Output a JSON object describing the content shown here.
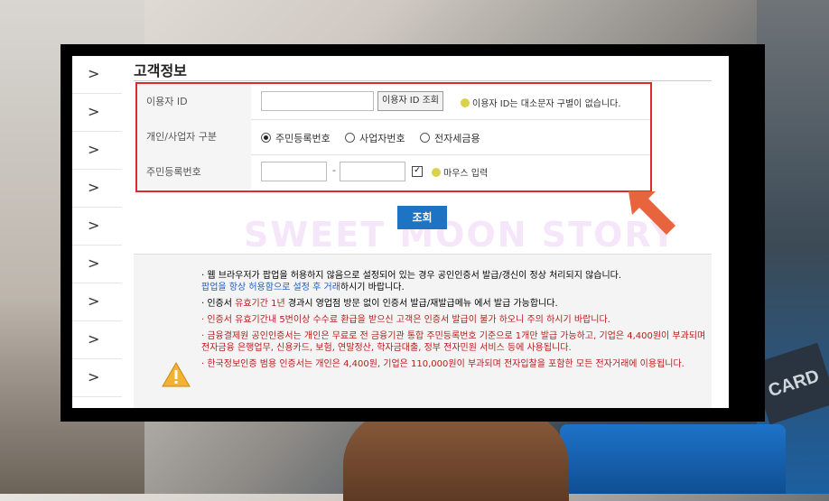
{
  "background": {
    "card_text": "CARD"
  },
  "nav": {
    "chevron": ">",
    "rows": 9
  },
  "section": {
    "title": "고객정보"
  },
  "form": {
    "user_id_label": "이용자 ID",
    "user_id_value": "",
    "user_id_check_button": "이용자 ID 조회",
    "user_id_note": "이용자 ID는 대소문자 구별이 없습니다.",
    "type_label": "개인/사업자 구분",
    "radio_options": [
      "주민등록번호",
      "사업자번호",
      "전자세금용"
    ],
    "selected_radio": "주민등록번호",
    "rrn_label": "주민등록번호",
    "rrn_part1": "",
    "rrn_dash": "-",
    "rrn_part2": "",
    "mouse_input_checked": true,
    "mouse_input_label": "마우스 입력"
  },
  "search_button": "조회",
  "watermark": "SWEET MOON STORY",
  "info": {
    "items": [
      {
        "text": "웹 브라우저가 팝업을 허용하지 않음으로 설정되어 있는 경우 공인인증서 발급/갱신이 정상 처리되지 않습니다.",
        "text2": "팝업을 항상 허용함으로 설정 후 거래",
        "text3": "하시기 바랍니다."
      },
      {
        "text": "인증서 ",
        "text2": "유효기간 1년",
        "text3": " 경과시 영업점 방문 없이 인증서 발급/재발급메뉴 에서 발급 가능합니다."
      },
      {
        "text": "인증서 유효기간내 5번이상 수수료 환급을 받으신 고객은 인증서 발급이 불가 하오니 주의 하시기 바랍니다."
      },
      {
        "text": "금융결제원 공인인증서는 개인은 무료로 전 금융기관 통합 주민등록번호 기준으로 1개만 발급 가능하고, 기업은 4,400원이 부과되며 전자금융 은행업무, 신용카드, 보험, 연말정산, 학자금대출, 정부 전자민원 서비스 등에 사용됩니다."
      },
      {
        "text": "한국정보인증 범용 인증서는 개인은 4,400원, 기업은 110,000원이 부과되며 전자입찰을 포함한 모든 전자거래에 이용됩니다."
      }
    ]
  },
  "colors": {
    "highlight_border": "#e02a2a",
    "button": "#1d74c4",
    "arrow": "#e8643c"
  }
}
